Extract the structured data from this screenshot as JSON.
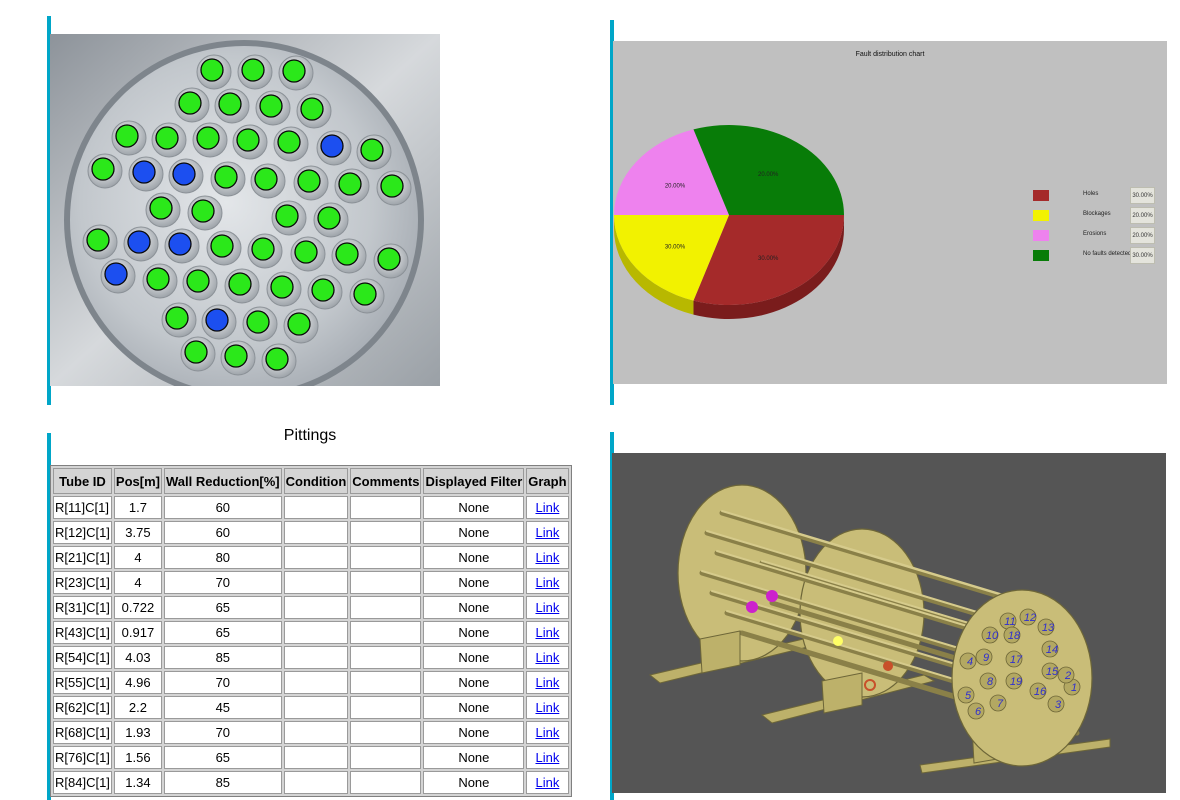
{
  "tube_sheet": {
    "icon": "tube-sheet-photo",
    "colors": {
      "ok": "#2be81a",
      "fault": "#1c4ff0"
    }
  },
  "fault_chart": {
    "title": "Fault distribution chart",
    "slice_labels": [
      "30.00%",
      "30.00%",
      "20.00%",
      "20.00%"
    ],
    "legend": [
      {
        "label": "Holes",
        "value": "30.00%",
        "color": "#a52a2a"
      },
      {
        "label": "Blockages",
        "value": "20.00%",
        "color": "#f2f200"
      },
      {
        "label": "Erosions",
        "value": "20.00%",
        "color": "#ee82ee"
      },
      {
        "label": "No faults detected",
        "value": "30.00%",
        "color": "#087c08"
      }
    ]
  },
  "chart_data": {
    "type": "pie",
    "title": "Fault distribution chart",
    "categories": [
      "Holes",
      "Blockages",
      "Erosions",
      "No faults detected"
    ],
    "values": [
      30,
      20,
      20,
      30
    ],
    "legend_position": "right"
  },
  "pittings": {
    "title": "Pittings",
    "columns": [
      "Tube ID",
      "Pos[m]",
      "Wall Reduction[%]",
      "Condition",
      "Comments",
      "Displayed Filter",
      "Graph"
    ],
    "rows": [
      {
        "tube_id": "R[11]C[1]",
        "pos": "1.7",
        "wall": "60",
        "condition": "",
        "comments": "",
        "filter": "None",
        "graph": "Link"
      },
      {
        "tube_id": "R[12]C[1]",
        "pos": "3.75",
        "wall": "60",
        "condition": "",
        "comments": "",
        "filter": "None",
        "graph": "Link"
      },
      {
        "tube_id": "R[21]C[1]",
        "pos": "4",
        "wall": "80",
        "condition": "",
        "comments": "",
        "filter": "None",
        "graph": "Link"
      },
      {
        "tube_id": "R[23]C[1]",
        "pos": "4",
        "wall": "70",
        "condition": "",
        "comments": "",
        "filter": "None",
        "graph": "Link"
      },
      {
        "tube_id": "R[31]C[1]",
        "pos": "0.722",
        "wall": "65",
        "condition": "",
        "comments": "",
        "filter": "None",
        "graph": "Link"
      },
      {
        "tube_id": "R[43]C[1]",
        "pos": "0.917",
        "wall": "65",
        "condition": "",
        "comments": "",
        "filter": "None",
        "graph": "Link"
      },
      {
        "tube_id": "R[54]C[1]",
        "pos": "4.03",
        "wall": "85",
        "condition": "",
        "comments": "",
        "filter": "None",
        "graph": "Link"
      },
      {
        "tube_id": "R[55]C[1]",
        "pos": "4.96",
        "wall": "70",
        "condition": "",
        "comments": "",
        "filter": "None",
        "graph": "Link"
      },
      {
        "tube_id": "R[62]C[1]",
        "pos": "2.2",
        "wall": "45",
        "condition": "",
        "comments": "",
        "filter": "None",
        "graph": "Link"
      },
      {
        "tube_id": "R[68]C[1]",
        "pos": "1.93",
        "wall": "70",
        "condition": "",
        "comments": "",
        "filter": "None",
        "graph": "Link"
      },
      {
        "tube_id": "R[76]C[1]",
        "pos": "1.56",
        "wall": "65",
        "condition": "",
        "comments": "",
        "filter": "None",
        "graph": "Link"
      },
      {
        "tube_id": "R[84]C[1]",
        "pos": "1.34",
        "wall": "85",
        "condition": "",
        "comments": "",
        "filter": "None",
        "graph": "Link"
      }
    ]
  },
  "model_view": {
    "icon": "heat-exchanger-3d-model",
    "tube_numbers": [
      "1",
      "2",
      "3",
      "4",
      "5",
      "6",
      "7",
      "8",
      "9",
      "10",
      "11",
      "12",
      "13",
      "14",
      "15",
      "16",
      "17",
      "18",
      "19"
    ]
  }
}
